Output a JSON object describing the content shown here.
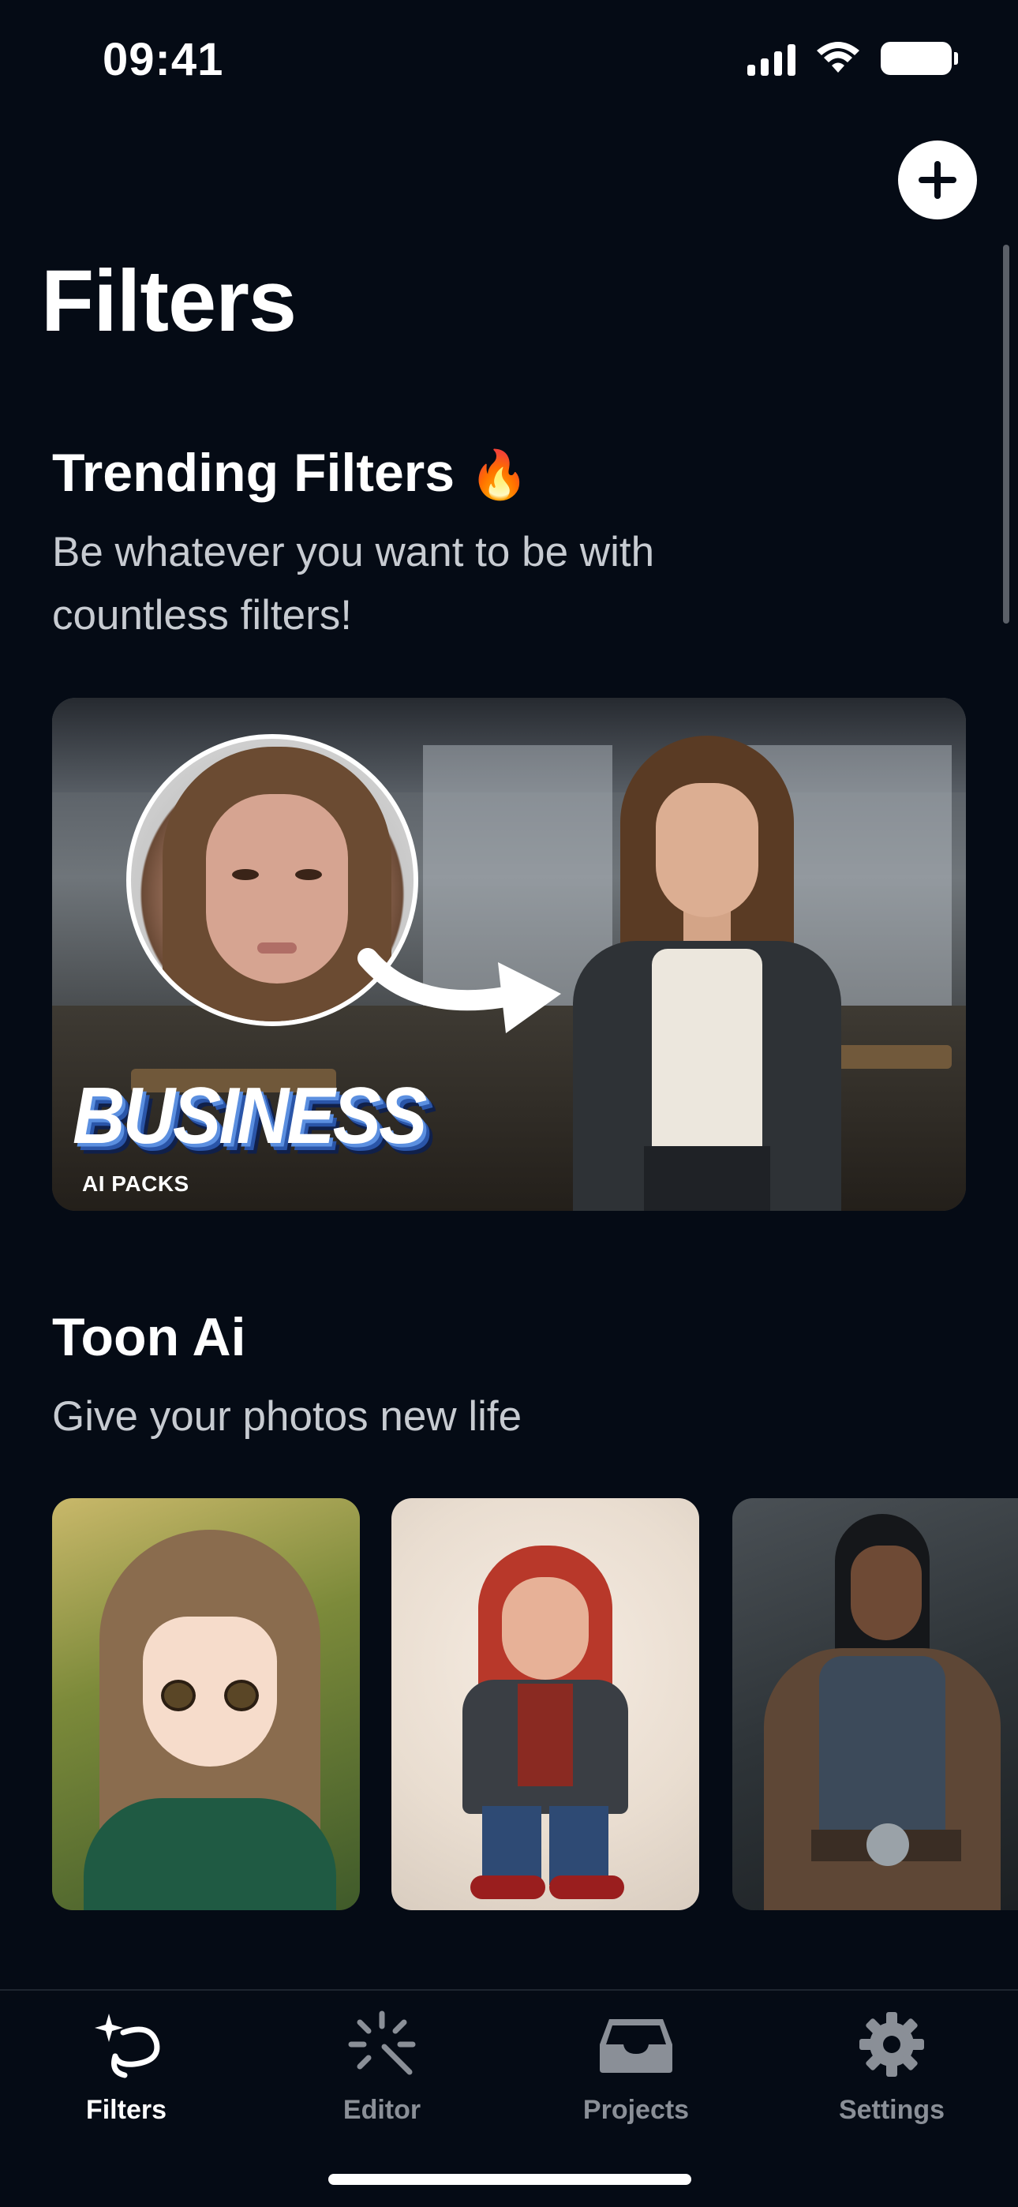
{
  "status_bar": {
    "time": "09:41"
  },
  "header": {
    "title": "Filters",
    "add_icon": "plus-circle-icon"
  },
  "sections": {
    "trending": {
      "title": "Trending Filters",
      "emoji": "🔥",
      "subtitle_line1": "Be whatever you want to be with",
      "subtitle_line2": "countless filters!",
      "banner": {
        "logo_text": "BUSINESS",
        "caption": "AI PACKS"
      }
    },
    "toon": {
      "title": "Toon Ai",
      "subtitle": "Give your photos new life"
    }
  },
  "tab_bar": {
    "items": [
      {
        "label": "Filters",
        "icon": "sparkle-lasso-icon",
        "active": true
      },
      {
        "label": "Editor",
        "icon": "magic-wand-icon",
        "active": false
      },
      {
        "label": "Projects",
        "icon": "inbox-tray-icon",
        "active": false
      },
      {
        "label": "Settings",
        "icon": "gear-icon",
        "active": false
      }
    ]
  },
  "colors": {
    "background": "#050b15",
    "text_primary": "#ffffff",
    "text_secondary": "#c7cbd1",
    "tab_inactive": "#8a8f97"
  }
}
